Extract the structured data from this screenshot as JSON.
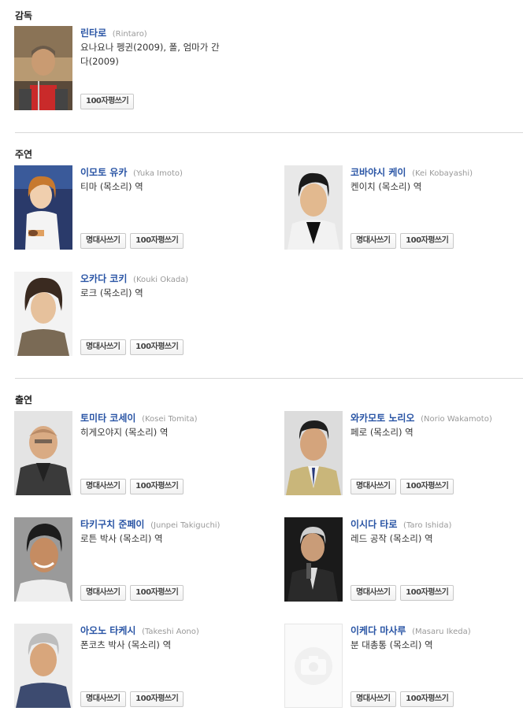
{
  "director": {
    "title": "감독",
    "people": [
      {
        "name": "린타로",
        "romaji": "(Rintaro)",
        "role": "요나요나 펭귄(2009), 폴, 엄마가 간다(2009)",
        "buttons": [
          "100자평쓰기"
        ],
        "photo": "director"
      }
    ]
  },
  "lead": {
    "title": "주연",
    "people": [
      {
        "name": "이모토 유카",
        "romaji": "(Yuka Imoto)",
        "role": "티마 (목소리) 역",
        "buttons": [
          "명대사쓰기",
          "100자평쓰기"
        ],
        "photo": "woman"
      },
      {
        "name": "코바야시 케이",
        "romaji": "(Kei Kobayashi)",
        "role": "켄이치 (목소리) 역",
        "buttons": [
          "명대사쓰기",
          "100자평쓰기"
        ],
        "photo": "young-man"
      },
      {
        "name": "오카다 코키",
        "romaji": "(Kouki Okada)",
        "role": "로크 (목소리) 역",
        "buttons": [
          "명대사쓰기",
          "100자평쓰기"
        ],
        "photo": "curly-man"
      }
    ]
  },
  "cast": {
    "title": "출연",
    "people": [
      {
        "name": "토미타 코세이",
        "romaji": "(Kosei Tomita)",
        "role": "히게오야지 (목소리) 역",
        "buttons": [
          "명대사쓰기",
          "100자평쓰기"
        ],
        "photo": "bald-man"
      },
      {
        "name": "와카모토 노리오",
        "romaji": "(Norio Wakamoto)",
        "role": "페로 (목소리) 역",
        "buttons": [
          "명대사쓰기",
          "100자평쓰기"
        ],
        "photo": "suit-man"
      },
      {
        "name": "타키구치 준페이",
        "romaji": "(Junpei Takiguchi)",
        "role": "로튼 박사 (목소리) 역",
        "buttons": [
          "명대사쓰기",
          "100자평쓰기"
        ],
        "photo": "smiling-man"
      },
      {
        "name": "이시다 타로",
        "romaji": "(Taro Ishida)",
        "role": "레드 공작 (목소리) 역",
        "buttons": [
          "명대사쓰기",
          "100자평쓰기"
        ],
        "photo": "mic-man"
      },
      {
        "name": "아오노 타케시",
        "romaji": "(Takeshi Aono)",
        "role": "폰코츠 박사 (목소리) 역",
        "buttons": [
          "명대사쓰기",
          "100자평쓰기"
        ],
        "photo": "old-man"
      },
      {
        "name": "이케다 마사루",
        "romaji": "(Masaru Ikeda)",
        "role": "분 대총통 (목소리) 역",
        "buttons": [
          "명대사쓰기",
          "100자평쓰기"
        ],
        "photo": "placeholder"
      }
    ]
  },
  "colors": {
    "name_link": "#2a55a5",
    "romaji": "#999999",
    "divider": "#d8d8d8"
  }
}
